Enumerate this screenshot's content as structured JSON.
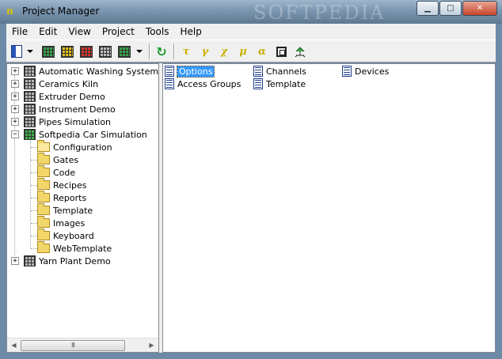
{
  "window": {
    "title": "Project Manager",
    "watermark": "SOFTPEDIA",
    "controls": {
      "minimize": "▁",
      "maximize": "□",
      "close": "✕"
    }
  },
  "menubar": [
    "File",
    "Edit",
    "View",
    "Project",
    "Tools",
    "Help"
  ],
  "toolbar": {
    "glyphs": {
      "tag1": "τ",
      "tag2": "γ",
      "tag3": "χ",
      "tag4": "μ",
      "tag5": "α",
      "refresh": "↻"
    }
  },
  "tree": {
    "projects_before": [
      {
        "label": "Automatic Washing System Der"
      },
      {
        "label": "Ceramics Kiln"
      },
      {
        "label": "Extruder Demo"
      },
      {
        "label": "Instrument Demo"
      },
      {
        "label": "Pipes Simulation"
      }
    ],
    "open_project": {
      "label": "Softpedia Car Simulation",
      "children": [
        "Configuration",
        "Gates",
        "Code",
        "Recipes",
        "Reports",
        "Template",
        "Images",
        "Keyboard",
        "WebTemplate"
      ]
    },
    "projects_after": [
      {
        "label": "Yarn Plant Demo"
      }
    ],
    "expand_plus": "+",
    "expand_minus": "−"
  },
  "list": {
    "items": [
      "Options",
      "Channels",
      "Devices",
      "Access Groups",
      "Template"
    ],
    "selected": "Options"
  },
  "scrollbar": {
    "left_arrow": "◀",
    "right_arrow": "▶",
    "grip": "III"
  }
}
